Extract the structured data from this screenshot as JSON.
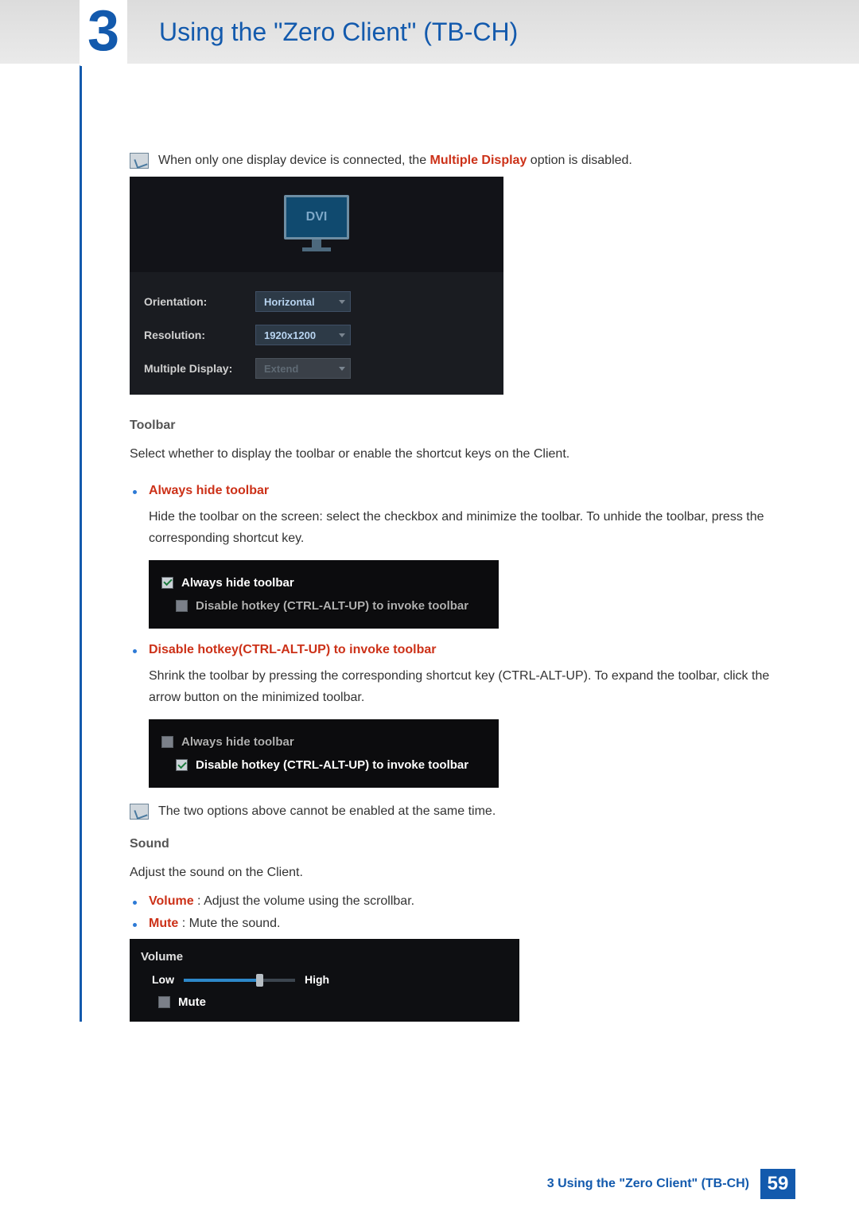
{
  "header": {
    "chapter_number": "3",
    "title": "Using the \"Zero Client\" (TB-CH)"
  },
  "note1": {
    "prefix": "When only one display device is connected, the ",
    "highlight": "Multiple Display",
    "suffix": " option is disabled."
  },
  "display_panel": {
    "monitor_label": "DVI",
    "settings": [
      {
        "label": "Orientation:",
        "value": "Horizontal",
        "disabled": false
      },
      {
        "label": "Resolution:",
        "value": "1920x1200",
        "disabled": false
      },
      {
        "label": "Multiple Display:",
        "value": "Extend",
        "disabled": true
      }
    ]
  },
  "toolbar_section": {
    "heading": "Toolbar",
    "body": "Select whether to display the toolbar or enable the shortcut keys on the Client."
  },
  "bullet_always_hide": {
    "title": "Always hide toolbar",
    "desc": "Hide the toolbar on the screen: select the checkbox and minimize the toolbar. To unhide the toolbar, press the corresponding shortcut key."
  },
  "cb_panel1": {
    "row1": {
      "checked": true,
      "label": "Always hide toolbar"
    },
    "row2": {
      "checked": false,
      "label": "Disable hotkey (CTRL-ALT-UP) to invoke toolbar"
    }
  },
  "bullet_disable_hotkey": {
    "title": "Disable hotkey(CTRL-ALT-UP) to invoke toolbar",
    "desc": "Shrink the toolbar by pressing the corresponding shortcut key (CTRL-ALT-UP). To expand the toolbar, click the arrow button on the minimized toolbar."
  },
  "cb_panel2": {
    "row1": {
      "checked": false,
      "label": "Always hide toolbar"
    },
    "row2": {
      "checked": true,
      "label": "Disable hotkey (CTRL-ALT-UP) to invoke toolbar"
    }
  },
  "note2": {
    "text": "The two options above cannot be enabled at the same time."
  },
  "sound_section": {
    "heading": "Sound",
    "body": "Adjust the sound on the Client."
  },
  "sound_bullets": {
    "volume_label": "Volume",
    "volume_desc": " : Adjust the volume using the scrollbar.",
    "mute_label": "Mute",
    "mute_desc": " : Mute the sound."
  },
  "volume_panel": {
    "title": "Volume",
    "low": "Low",
    "high": "High",
    "mute": "Mute",
    "mute_checked": false,
    "slider_percent": 68
  },
  "footer": {
    "text": "3 Using the \"Zero Client\" (TB-CH)",
    "page": "59"
  }
}
